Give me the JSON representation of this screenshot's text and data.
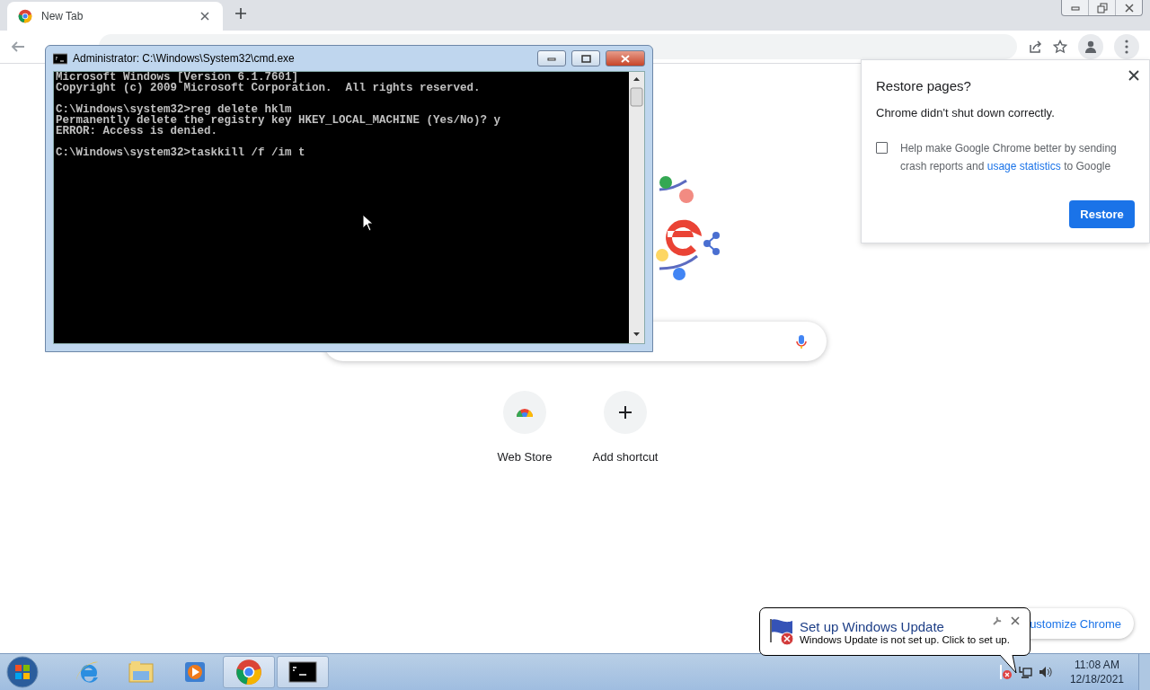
{
  "browser": {
    "tabs": [
      {
        "title": "New Tab",
        "selected": true
      }
    ],
    "shortcuts": [
      {
        "label": "Web Store",
        "kind": "store"
      },
      {
        "label": "Add shortcut",
        "kind": "add"
      }
    ],
    "customize_button": "ustomize Chrome"
  },
  "restore_dialog": {
    "title": "Restore pages?",
    "message": "Chrome didn't shut down correctly.",
    "checkbox": {
      "text_before": "Help make Google Chrome better by sending crash reports and",
      "link": "usage statistics",
      "text_after": "to Google",
      "checked": false
    },
    "button": "Restore"
  },
  "console": {
    "title": "Administrator: C:\\Windows\\System32\\cmd.exe",
    "blocks": [
      [
        "Microsoft Windows [Version 6.1.7601]",
        "Copyright (c) 2009 Microsoft Corporation.  All rights reserved."
      ],
      [
        "C:\\Windows\\system32>reg delete hklm",
        "Permanently delete the registry key HKEY_LOCAL_MACHINE (Yes/No)? y",
        "ERROR: Access is denied."
      ],
      [
        "C:\\Windows\\system32>taskkill /f /im t"
      ]
    ]
  },
  "notification": {
    "title": "Set up Windows Update",
    "message": "Windows Update is not set up. Click to set up."
  },
  "taskbar": {
    "apps": [
      {
        "kind": "ie",
        "open": false
      },
      {
        "kind": "folder",
        "open": false
      },
      {
        "kind": "media",
        "open": false
      },
      {
        "kind": "chrome",
        "open": true
      },
      {
        "kind": "console",
        "open": true
      }
    ],
    "time": "11:08 AM",
    "date": "12/18/2021"
  }
}
